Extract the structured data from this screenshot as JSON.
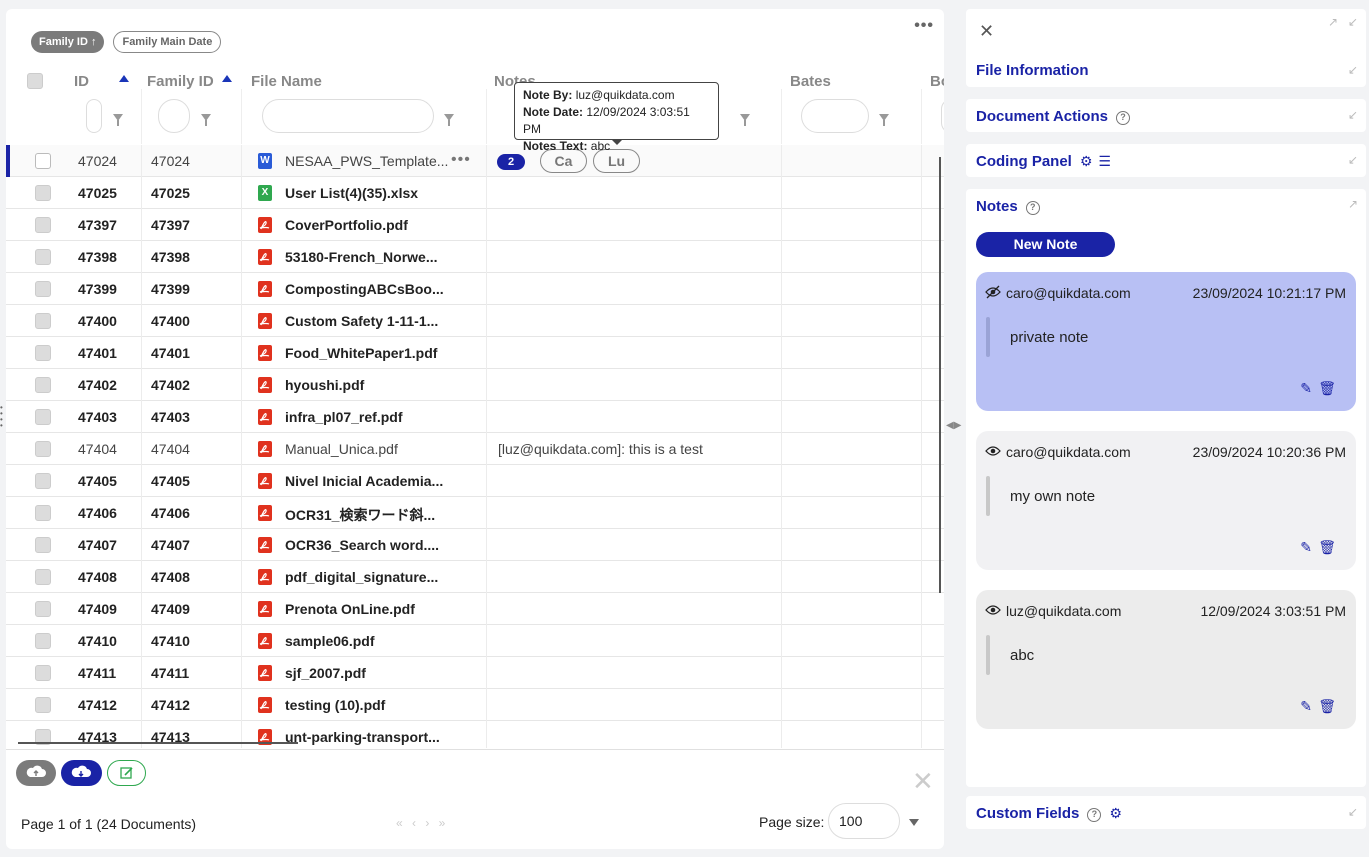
{
  "chips": {
    "family_id": "Family ID ↑",
    "family_main_date": "Family Main Date"
  },
  "more_menu": "•••",
  "columns": {
    "id": "ID",
    "family_id": "Family ID",
    "file_name": "File Name",
    "notes": "Notes",
    "bates": "Bates",
    "bo": "Bo"
  },
  "tooltip": {
    "note_by_label": "Note By:",
    "note_by": "luz@quikdata.com",
    "note_date_label": "Note Date:",
    "note_date": "12/09/2024 3:03:51 PM",
    "notes_text_label": "Notes Text:",
    "notes_text": "abc"
  },
  "rows": [
    {
      "id": "47024",
      "family_id": "47024",
      "file": "NESAA_PWS_Template...",
      "type": "doc",
      "icon_letter": "W",
      "note": "",
      "badge": "2",
      "tags": [
        "Ca",
        "Lu"
      ]
    },
    {
      "id": "47025",
      "family_id": "47025",
      "file": "User List(4)(35).xlsx",
      "type": "xls",
      "icon_letter": "X",
      "note": ""
    },
    {
      "id": "47397",
      "family_id": "47397",
      "file": "CoverPortfolio.pdf",
      "type": "pdf",
      "icon_letter": "",
      "note": ""
    },
    {
      "id": "47398",
      "family_id": "47398",
      "file": "53180-French_Norwe...",
      "type": "pdf",
      "icon_letter": "",
      "note": ""
    },
    {
      "id": "47399",
      "family_id": "47399",
      "file": "CompostingABCsBoo...",
      "type": "pdf",
      "icon_letter": "",
      "note": ""
    },
    {
      "id": "47400",
      "family_id": "47400",
      "file": "Custom Safety 1-11-1...",
      "type": "pdf",
      "icon_letter": "",
      "note": ""
    },
    {
      "id": "47401",
      "family_id": "47401",
      "file": "Food_WhitePaper1.pdf",
      "type": "pdf",
      "icon_letter": "",
      "note": ""
    },
    {
      "id": "47402",
      "family_id": "47402",
      "file": "hyoushi.pdf",
      "type": "pdf",
      "icon_letter": "",
      "note": ""
    },
    {
      "id": "47403",
      "family_id": "47403",
      "file": "infra_pl07_ref.pdf",
      "type": "pdf",
      "icon_letter": "",
      "note": ""
    },
    {
      "id": "47404",
      "family_id": "47404",
      "file": "Manual_Unica.pdf",
      "type": "pdf",
      "icon_letter": "",
      "note": "[luz@quikdata.com]: this is a test"
    },
    {
      "id": "47405",
      "family_id": "47405",
      "file": "Nivel Inicial Academia...",
      "type": "pdf",
      "icon_letter": "",
      "note": ""
    },
    {
      "id": "47406",
      "family_id": "47406",
      "file": "OCR31_検索ワード斜...",
      "type": "pdf",
      "icon_letter": "",
      "note": ""
    },
    {
      "id": "47407",
      "family_id": "47407",
      "file": "OCR36_Search word....",
      "type": "pdf",
      "icon_letter": "",
      "note": ""
    },
    {
      "id": "47408",
      "family_id": "47408",
      "file": "pdf_digital_signature...",
      "type": "pdf",
      "icon_letter": "",
      "note": ""
    },
    {
      "id": "47409",
      "family_id": "47409",
      "file": "Prenota OnLine.pdf",
      "type": "pdf",
      "icon_letter": "",
      "note": ""
    },
    {
      "id": "47410",
      "family_id": "47410",
      "file": "sample06.pdf",
      "type": "pdf",
      "icon_letter": "",
      "note": ""
    },
    {
      "id": "47411",
      "family_id": "47411",
      "file": "sjf_2007.pdf",
      "type": "pdf",
      "icon_letter": "",
      "note": ""
    },
    {
      "id": "47412",
      "family_id": "47412",
      "file": "testing (10).pdf",
      "type": "pdf",
      "icon_letter": "",
      "note": ""
    },
    {
      "id": "47413",
      "family_id": "47413",
      "file": "unt-parking-transport...",
      "type": "pdf",
      "icon_letter": "",
      "note": ""
    }
  ],
  "pager": {
    "text": "Page 1 of 1 (24 Documents)",
    "page_size_label": "Page size:",
    "page_size": "100",
    "nav": "« ‹ › »"
  },
  "right_panel": {
    "close": "✕",
    "sections": {
      "file_information": "File Information",
      "document_actions": "Document Actions",
      "coding_panel": "Coding Panel",
      "notes": "Notes",
      "custom_fields": "Custom Fields"
    },
    "new_note": "New Note",
    "notes": [
      {
        "author": "caro@quikdata.com",
        "date": "23/09/2024 10:21:17 PM",
        "text": "private note",
        "visibility": "private"
      },
      {
        "author": "caro@quikdata.com",
        "date": "23/09/2024 10:20:36 PM",
        "text": "my own note",
        "visibility": "public"
      },
      {
        "author": "luz@quikdata.com",
        "date": "12/09/2024 3:03:51 PM",
        "text": "abc",
        "visibility": "public"
      }
    ]
  },
  "colors": {
    "accent": "#1a23a6",
    "pdf": "#e0321e",
    "xls": "#2fa84f",
    "doc": "#2a5bd7",
    "private_note": "#b8c0f4"
  }
}
